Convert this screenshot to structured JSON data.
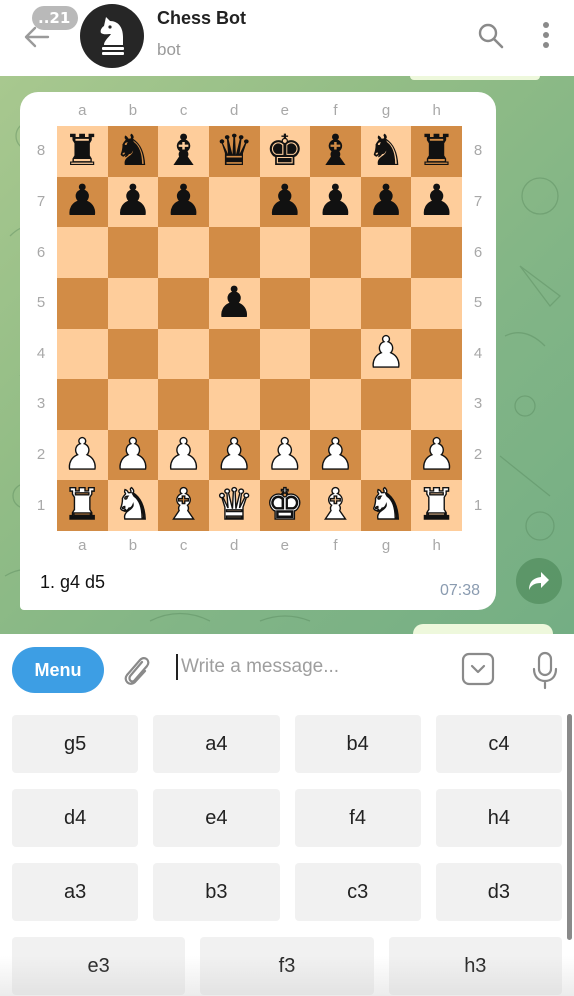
{
  "header": {
    "unread_count": "..21",
    "title": "Chess Bot",
    "subtitle": "bot"
  },
  "message": {
    "files": [
      "a",
      "b",
      "c",
      "d",
      "e",
      "f",
      "g",
      "h"
    ],
    "ranks": [
      "8",
      "7",
      "6",
      "5",
      "4",
      "3",
      "2",
      "1"
    ],
    "board": [
      [
        "bR",
        "bN",
        "bB",
        "bQ",
        "bK",
        "bB",
        "bN",
        "bR"
      ],
      [
        "bP",
        "bP",
        "bP",
        "",
        "bP",
        "bP",
        "bP",
        "bP"
      ],
      [
        "",
        "",
        "",
        "",
        "",
        "",
        "",
        ""
      ],
      [
        "",
        "",
        "",
        "bP",
        "",
        "",
        "",
        ""
      ],
      [
        "",
        "",
        "",
        "",
        "",
        "",
        "wP",
        ""
      ],
      [
        "",
        "",
        "",
        "",
        "",
        "",
        "",
        ""
      ],
      [
        "wP",
        "wP",
        "wP",
        "wP",
        "wP",
        "wP",
        "",
        "wP"
      ],
      [
        "wR",
        "wN",
        "wB",
        "wQ",
        "wK",
        "wB",
        "wN",
        "wR"
      ]
    ],
    "piece_glyphs": {
      "K": "♚",
      "Q": "♛",
      "R": "♜",
      "B": "♝",
      "N": "♞",
      "P": "♟"
    },
    "moves_text": "1. g4 d5",
    "time": "07:38",
    "colors": {
      "light_square": "#fecd9b",
      "dark_square": "#d28c46"
    }
  },
  "composer": {
    "menu_label": "Menu",
    "placeholder": "Write a message...",
    "value": ""
  },
  "keyboard": {
    "rows": [
      [
        "g5",
        "a4",
        "b4",
        "c4"
      ],
      [
        "d4",
        "e4",
        "f4",
        "h4"
      ],
      [
        "a3",
        "b3",
        "c3",
        "d3"
      ],
      [
        "e3",
        "f3",
        "h3"
      ]
    ]
  },
  "icons": {
    "back": "arrow-left-icon",
    "search": "search-icon",
    "more": "more-vertical-icon",
    "attach": "paperclip-icon",
    "keyboard_toggle": "chevron-down-box-icon",
    "mic": "microphone-icon",
    "forward": "forward-icon",
    "avatar": "chess-knight-icon"
  },
  "accent_color": "#3d9ee4"
}
